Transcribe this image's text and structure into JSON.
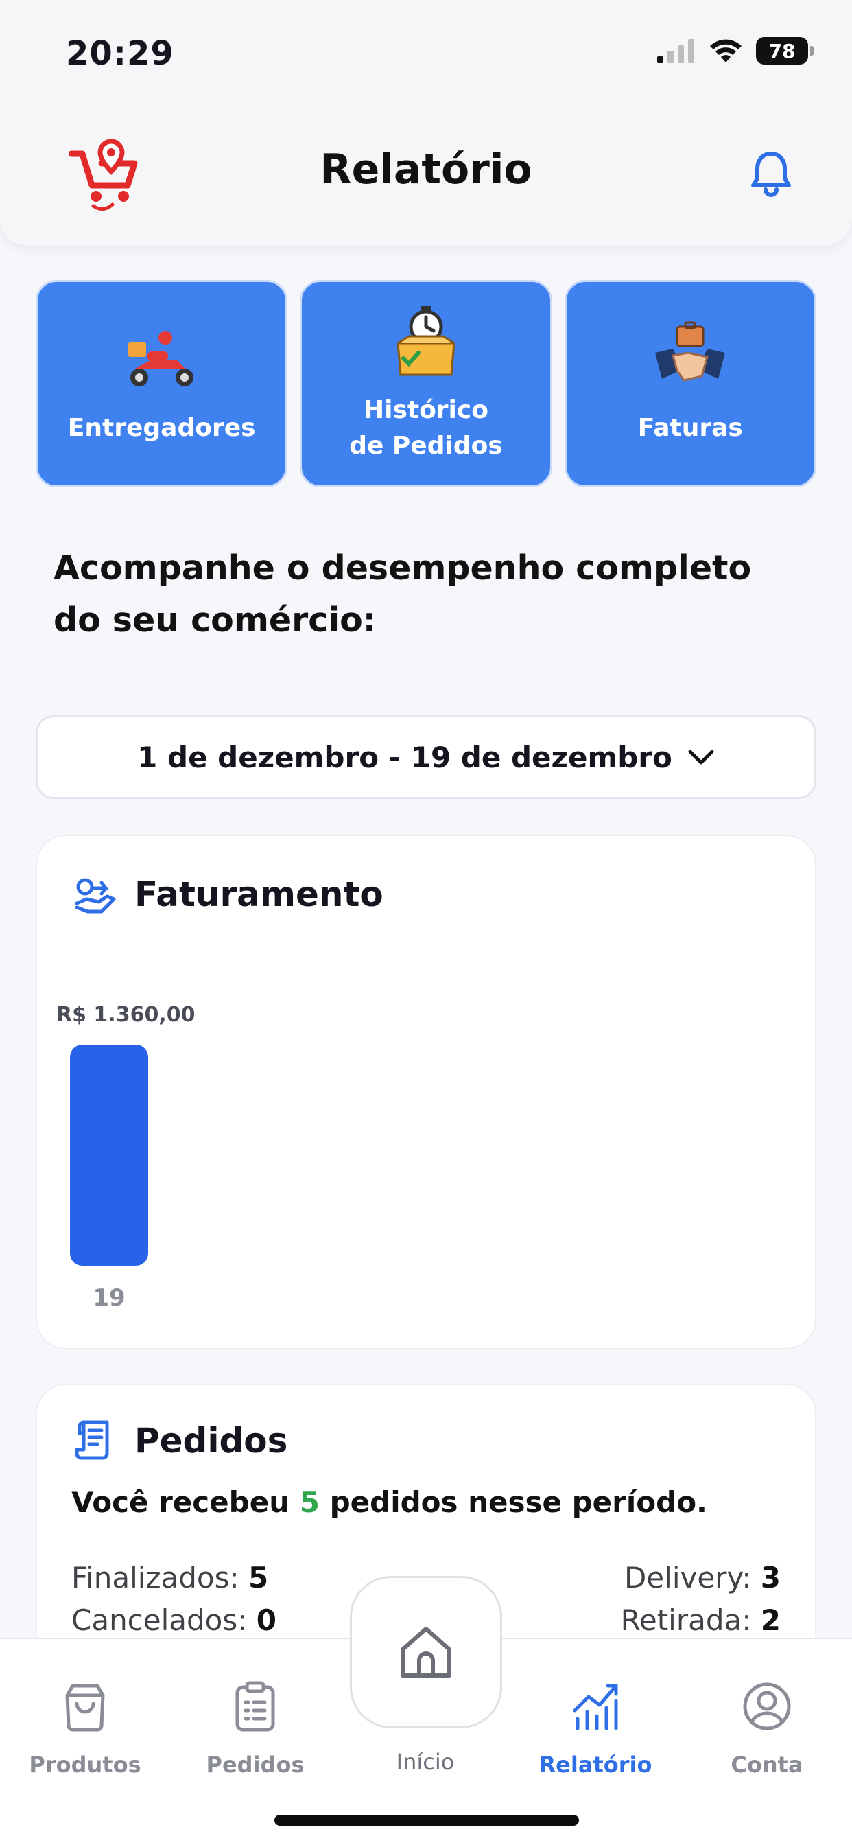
{
  "status_bar": {
    "time": "20:29",
    "battery": "78"
  },
  "header": {
    "title": "Relatório"
  },
  "shortcuts": [
    {
      "label": "Entregadores",
      "icon": "delivery-scooter-icon"
    },
    {
      "label": "Histórico\nde Pedidos",
      "icon": "order-box-timer-icon"
    },
    {
      "label": "Faturas",
      "icon": "handshake-briefcase-icon"
    }
  ],
  "intro_text": "Acompanhe o desempenho completo do seu comércio:",
  "date_range": {
    "value": "1 de dezembro - 19 de dezembro"
  },
  "faturamento": {
    "title": "Faturamento",
    "chart_data": {
      "type": "bar",
      "categories": [
        "19"
      ],
      "values": [
        1360.0
      ],
      "data_labels": [
        "R$ 1.360,00"
      ],
      "title": "Faturamento",
      "color": "#2762e8"
    }
  },
  "pedidos": {
    "title": "Pedidos",
    "summary_prefix": "Você recebeu ",
    "summary_count": "5",
    "summary_suffix": " pedidos nesse período.",
    "finalizados_label": "Finalizados:",
    "finalizados_value": "5",
    "cancelados_label": "Cancelados:",
    "cancelados_value": "0",
    "delivery_label": "Delivery:",
    "delivery_value": "3",
    "retirada_label": "Retirada:",
    "retirada_value": "2"
  },
  "bottom_nav": {
    "produtos": "Produtos",
    "pedidos": "Pedidos",
    "inicio": "Início",
    "relatorio": "Relatório",
    "conta": "Conta"
  },
  "colors": {
    "accent": "#3f82ef",
    "active_nav": "#2f6fe5",
    "positive": "#31a64d",
    "logo_red": "#e32a2a"
  }
}
